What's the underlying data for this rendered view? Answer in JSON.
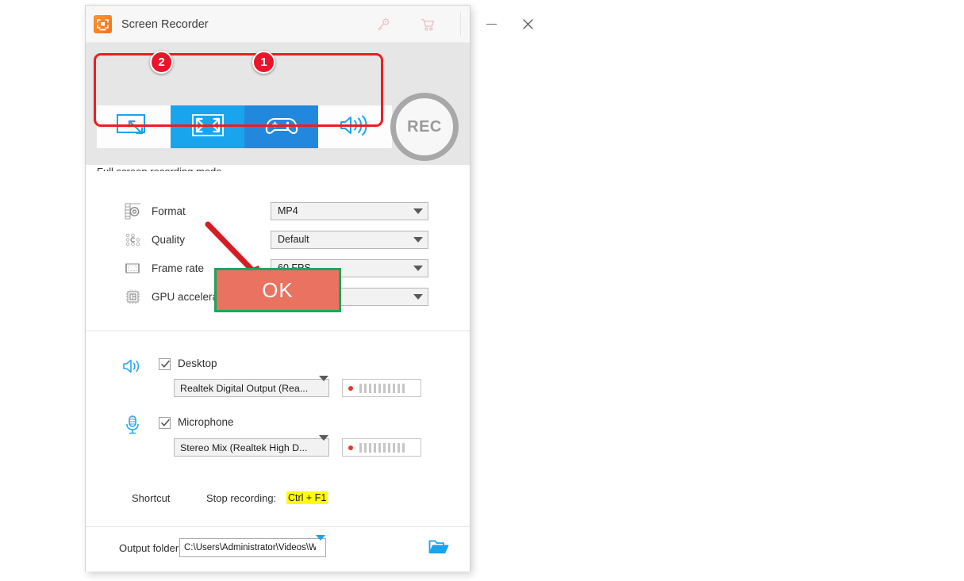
{
  "window": {
    "title": "Screen Recorder",
    "titlebar_icons": [
      {
        "name": "key-icon",
        "label": "Register"
      },
      {
        "name": "cart-icon",
        "label": "Buy"
      }
    ],
    "controls": {
      "minimize": "—",
      "close": "✕"
    }
  },
  "modebar": {
    "modes": [
      {
        "id": "custom-region",
        "icon": "custom-region-icon",
        "state": "normal"
      },
      {
        "id": "full-screen",
        "icon": "full-screen-icon",
        "state": "selected-light"
      },
      {
        "id": "game",
        "icon": "game-controller-icon",
        "state": "selected-dark"
      },
      {
        "id": "audio-only",
        "icon": "speaker-icon",
        "state": "normal"
      }
    ],
    "rec_label": "REC",
    "description": "Full screen recording mode.",
    "collapse_icon": "chevron-up-icon"
  },
  "settings": {
    "rows": [
      {
        "icon": "format-icon",
        "label": "Format",
        "value": "MP4"
      },
      {
        "icon": "quality-icon",
        "label": "Quality",
        "value": "Default"
      },
      {
        "icon": "frame-rate-icon",
        "label": "Frame rate",
        "value": "60 FPS"
      },
      {
        "icon": "gpu-icon",
        "label": "GPU acceleration",
        "value": ""
      }
    ]
  },
  "audio": {
    "desktop": {
      "icon": "speaker-icon",
      "label": "Desktop",
      "checked": true,
      "device": "Realtek Digital Output (Rea...",
      "meter_bars": 10
    },
    "microphone": {
      "icon": "microphone-icon",
      "label": "Microphone",
      "checked": true,
      "device": "Stereo Mix (Realtek High D...",
      "meter_bars": 10
    },
    "shortcut_label": "Shortcut",
    "stop_recording_label": "Stop recording:",
    "stop_recording_hotkey": "Ctrl + F1"
  },
  "footer": {
    "output_label": "Output folder:",
    "output_path": "C:\\Users\\Administrator\\Videos\\WonderFox Soft\\HD Vide",
    "folder_icon": "open-folder-icon"
  },
  "annotations": {
    "badge_one": "1",
    "badge_two": "2",
    "ok_label": "OK",
    "highlight_color": "#ee1d22",
    "badge_color": "#e8162a",
    "ok_fill": "#ea7260",
    "ok_border": "#1aa75f",
    "arrow_color": "#d41f20"
  }
}
